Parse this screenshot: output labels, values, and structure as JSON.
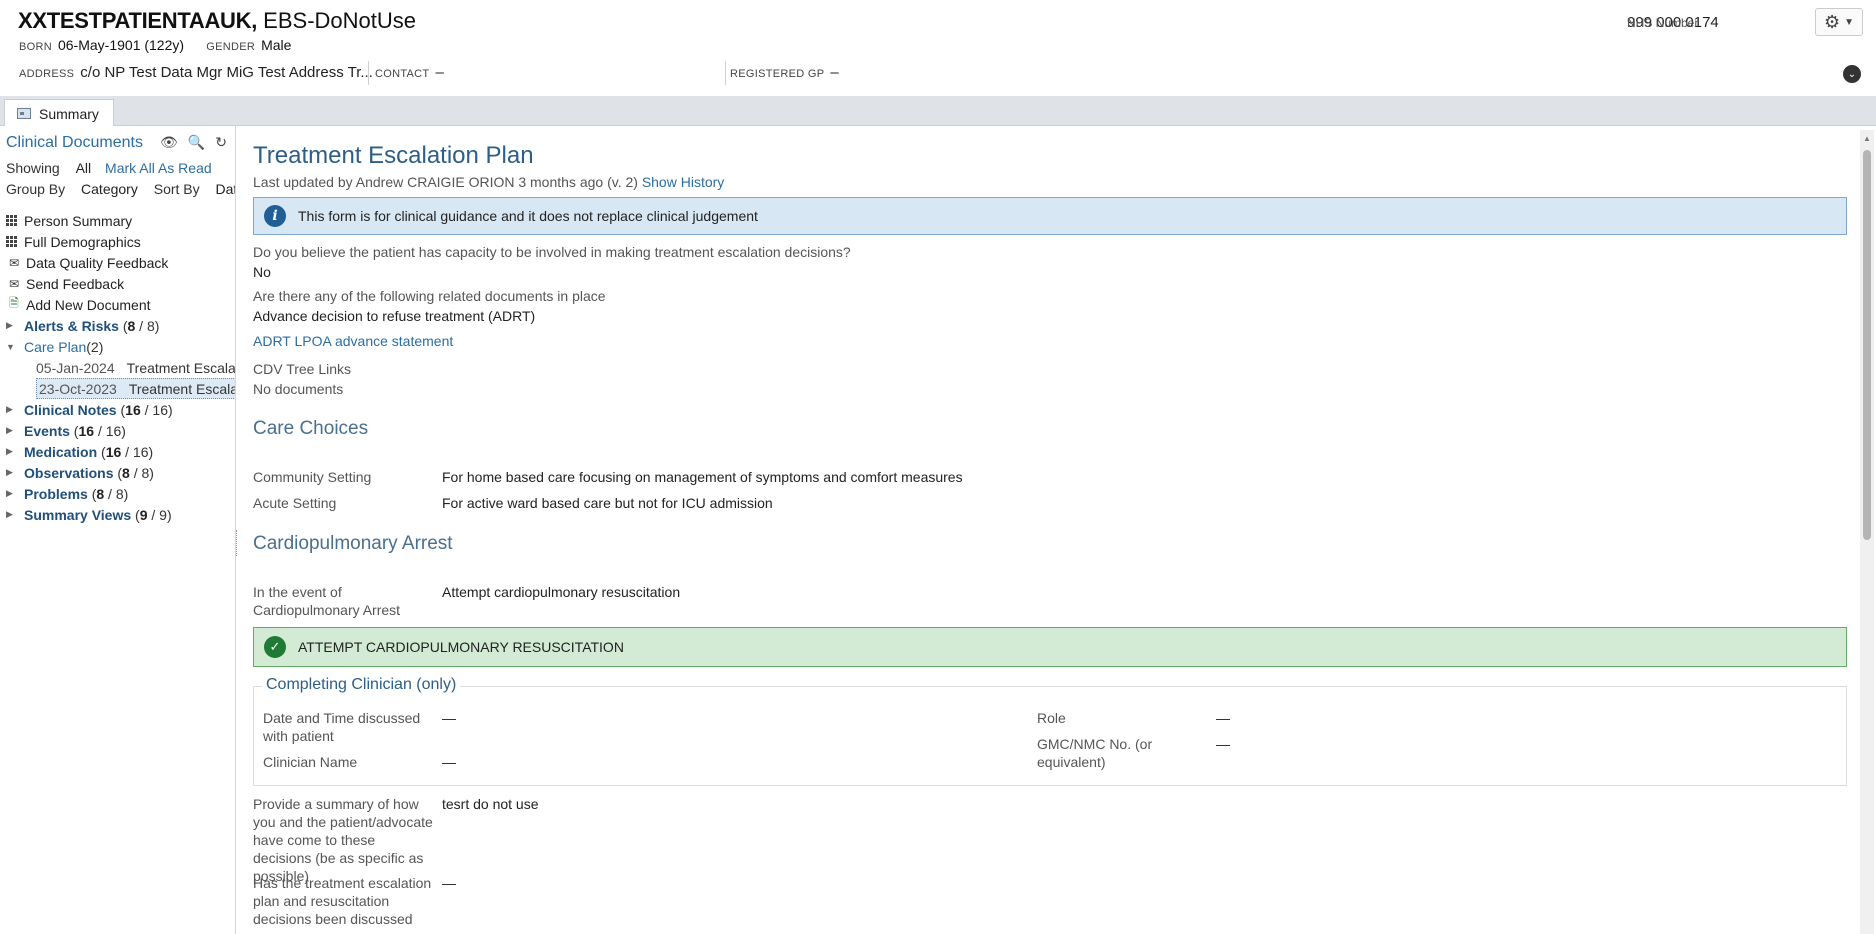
{
  "banner": {
    "name_bold": "XXTESTPATIENTAAUK,",
    "name_rest": " EBS-DoNotUse",
    "born_label": "BORN",
    "born_value": "06-May-1901 (122y)",
    "gender_label": "GENDER",
    "gender_value": "Male",
    "address_label": "ADDRESS",
    "address_value": "c/o NP Test Data Mgr MiG Test Address Tr...",
    "contact_label": "CONTACT",
    "contact_value": "–",
    "gp_label": "REGISTERED GP",
    "gp_value": "–",
    "nhs_label": "NHS Number",
    "nhs_value": "999 000 0174"
  },
  "tabs": [
    {
      "label": "Summary"
    }
  ],
  "sidebar": {
    "title": "Clinical Documents",
    "showing_label": "Showing",
    "showing_value": "All",
    "mark_all": "Mark All As Read",
    "group_by_label": "Group By",
    "group_by_value": "Category",
    "sort_by_label": "Sort By",
    "sort_by_value": "Date",
    "items": [
      {
        "label": "Person Summary"
      },
      {
        "label": "Full Demographics"
      },
      {
        "label": "Data Quality Feedback"
      },
      {
        "label": "Send Feedback"
      },
      {
        "label": "Add New Document"
      }
    ],
    "categories": [
      {
        "label": "Alerts & Risks",
        "unread": "8",
        "total": " / 8)"
      },
      {
        "label": "Care Plan",
        "count": " (2)"
      },
      {
        "label": "Clinical Notes",
        "unread": "16",
        "total": " / 16)"
      },
      {
        "label": "Events",
        "unread": "16",
        "total": " / 16)"
      },
      {
        "label": "Medication",
        "unread": "16",
        "total": " / 16)"
      },
      {
        "label": "Observations",
        "unread": "8",
        "total": " / 8)"
      },
      {
        "label": "Problems",
        "unread": "8",
        "total": " / 8)"
      },
      {
        "label": "Summary Views",
        "unread": "9",
        "total": " / 9)"
      }
    ],
    "care_plan_docs": [
      {
        "date": "05-Jan-2024",
        "title": "Treatment Escalati"
      },
      {
        "date": "23-Oct-2023",
        "title": "Treatment Escalati"
      }
    ]
  },
  "main": {
    "title": "Treatment Escalation Plan",
    "updated": "Last updated by Andrew CRAIGIE ORION 3 months ago (v. 2)",
    "show_history": "Show History",
    "info_text": "This form is for clinical guidance and it does not replace clinical judgement",
    "q_capacity": "Do you believe the patient has capacity to be involved in making treatment escalation decisions?",
    "a_capacity": "No",
    "q_docs": "Are there any of the following related documents in place",
    "a_docs": "Advance decision to refuse treatment (ADRT)",
    "adrt_link": "ADRT LPOA advance statement",
    "cdv_label": "CDV Tree Links",
    "cdv_value": "No documents",
    "care_choices_heading": "Care Choices",
    "community_label": "Community Setting",
    "community_value": "For home based care focusing on management of symptoms and comfort measures",
    "acute_label": "Acute Setting",
    "acute_value": "For active ward based care but not for ICU admission",
    "cpa_heading": "Cardiopulmonary Arrest",
    "cpa_label": "In the event of Cardiopulmonary Arrest",
    "cpa_value": "Attempt cardiopulmonary resuscitation",
    "cpa_banner": "ATTEMPT CARDIOPULMONARY RESUSCITATION",
    "clinician_legend": "Completing Clinician (only)",
    "date_label": "Date and Time discussed with patient",
    "date_value": "—",
    "clinician_name_label": "Clinician Name",
    "clinician_name_value": "—",
    "role_label": "Role",
    "role_value": "—",
    "gmc_label": "GMC/NMC No. (or equivalent)",
    "gmc_value": "—",
    "summary_label": "Provide a summary of how you and the patient/advocate have come to these decisions (be as specific as possible)",
    "summary_value": "tesrt do not use",
    "discussed_label": "Has the treatment escalation plan and resuscitation decisions been discussed",
    "discussed_value": "—"
  }
}
